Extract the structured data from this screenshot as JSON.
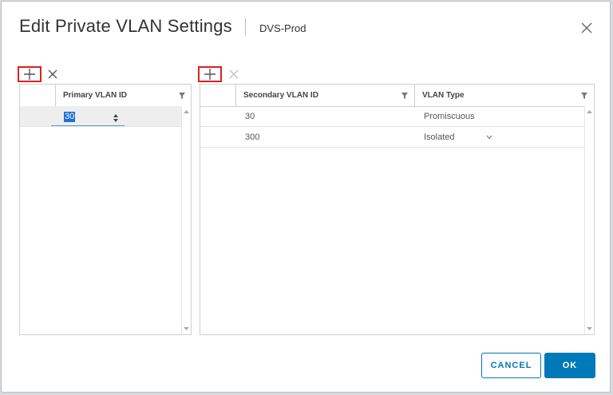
{
  "dialog": {
    "title": "Edit Private VLAN Settings",
    "subtitle": "DVS-Prod"
  },
  "primary_table": {
    "column_header": "Primary VLAN ID",
    "editing_value": "30"
  },
  "secondary_table": {
    "columns": [
      "Secondary VLAN ID",
      "VLAN Type"
    ],
    "rows": [
      {
        "id": "30",
        "type": "Promiscuous"
      },
      {
        "id": "300",
        "type": "Isolated"
      }
    ]
  },
  "buttons": {
    "cancel": "CANCEL",
    "ok": "OK"
  },
  "colors": {
    "accent": "#0079b8",
    "highlight_box": "#e02020",
    "selection": "#1e6fd9"
  }
}
